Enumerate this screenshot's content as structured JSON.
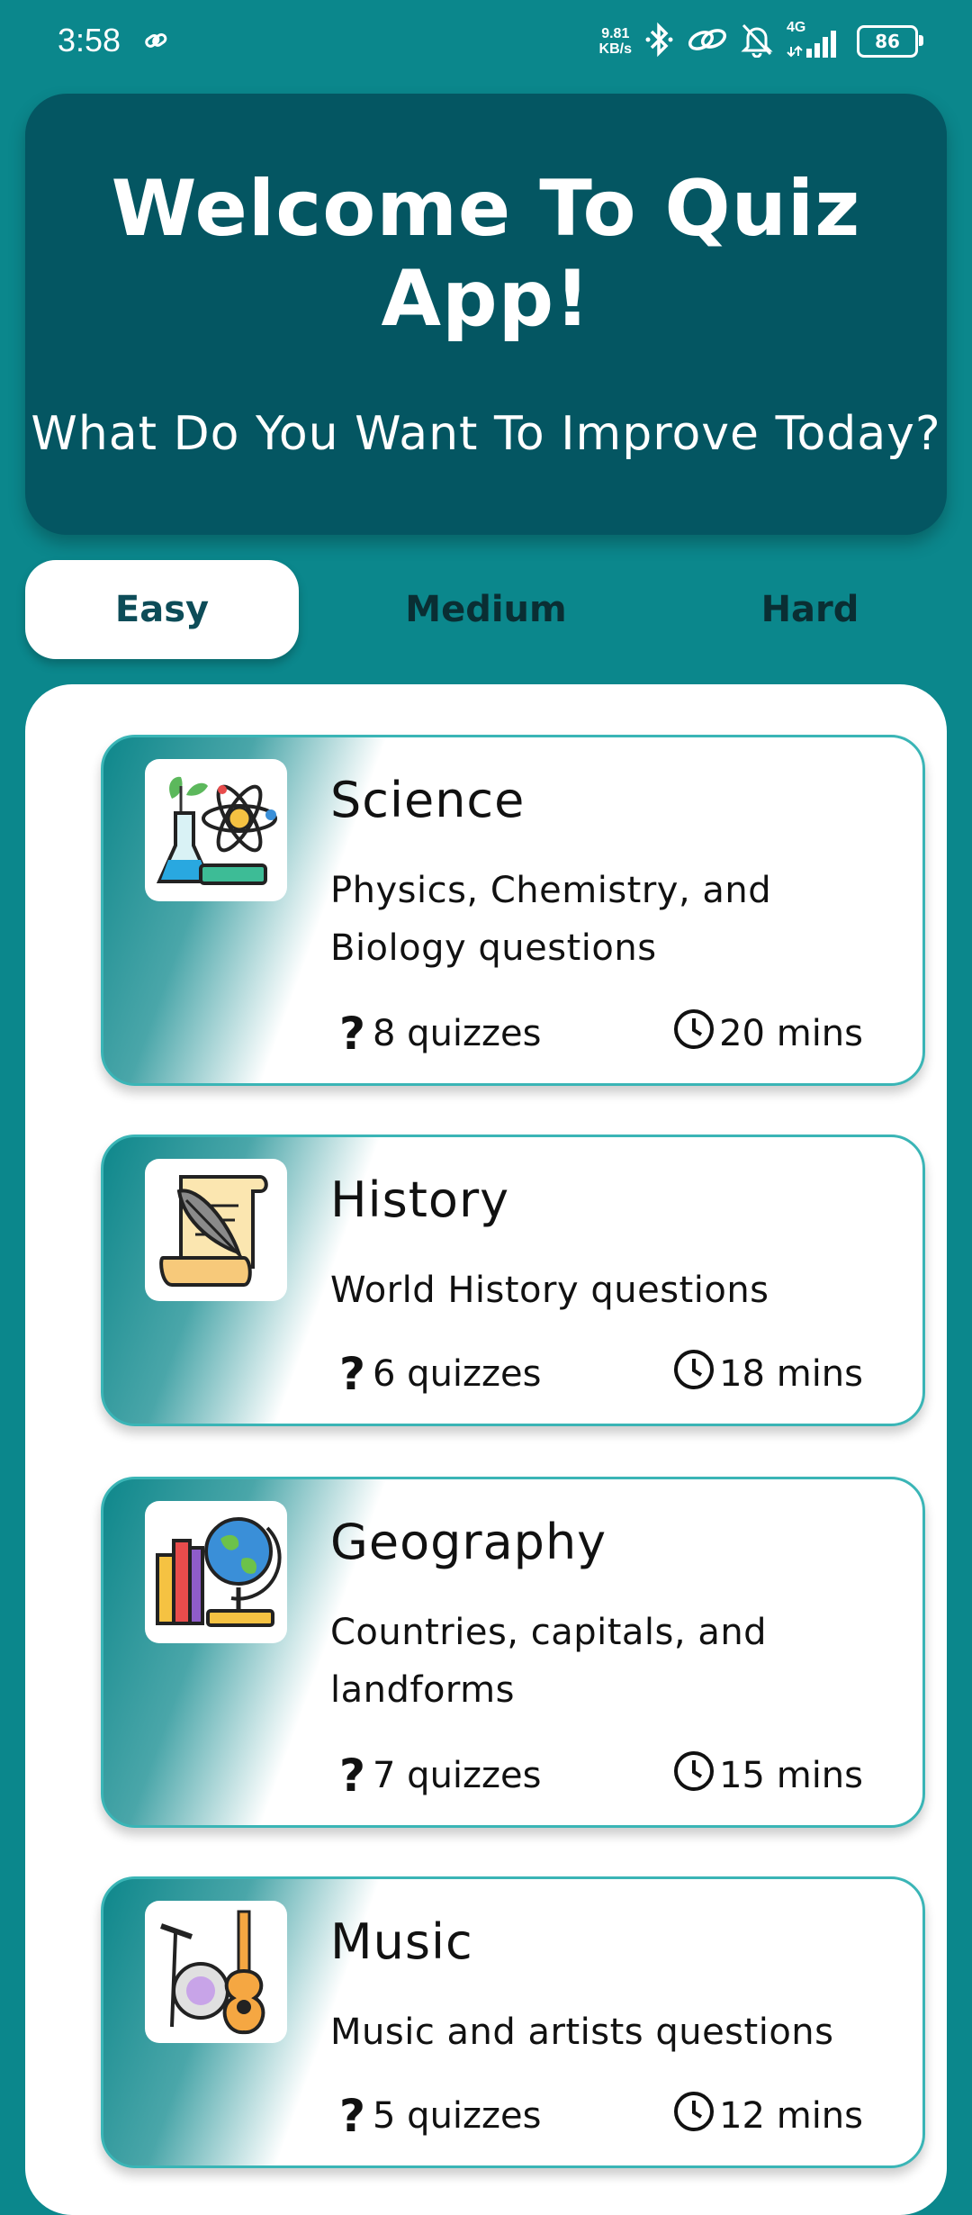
{
  "status": {
    "time": "3:58",
    "net_speed_value": "9.81",
    "net_speed_unit": "KB/s",
    "signal_type": "4G",
    "battery": "86"
  },
  "hero": {
    "title": "Welcome To Quiz App!",
    "subtitle": "What Do You Want To Improve Today?"
  },
  "tabs": [
    {
      "label": "Easy"
    },
    {
      "label": "Medium"
    },
    {
      "label": "Hard"
    }
  ],
  "cards": [
    {
      "title": "Science",
      "description": "Physics, Chemistry, and Biology questions",
      "quizzes": "8 quizzes",
      "duration": "20 mins",
      "icon": "science-icon"
    },
    {
      "title": "History",
      "description": "World History questions",
      "quizzes": "6 quizzes",
      "duration": "18 mins",
      "icon": "history-scroll-icon"
    },
    {
      "title": "Geography",
      "description": "Countries, capitals, and landforms",
      "quizzes": "7 quizzes",
      "duration": "15 mins",
      "icon": "globe-books-icon"
    },
    {
      "title": "Music",
      "description": "Music and artists questions",
      "quizzes": "5 quizzes",
      "duration": "12 mins",
      "icon": "guitar-drum-icon"
    }
  ],
  "colors": {
    "background": "#0b878c",
    "hero": "#045662",
    "card_border": "#3ab5b6"
  }
}
